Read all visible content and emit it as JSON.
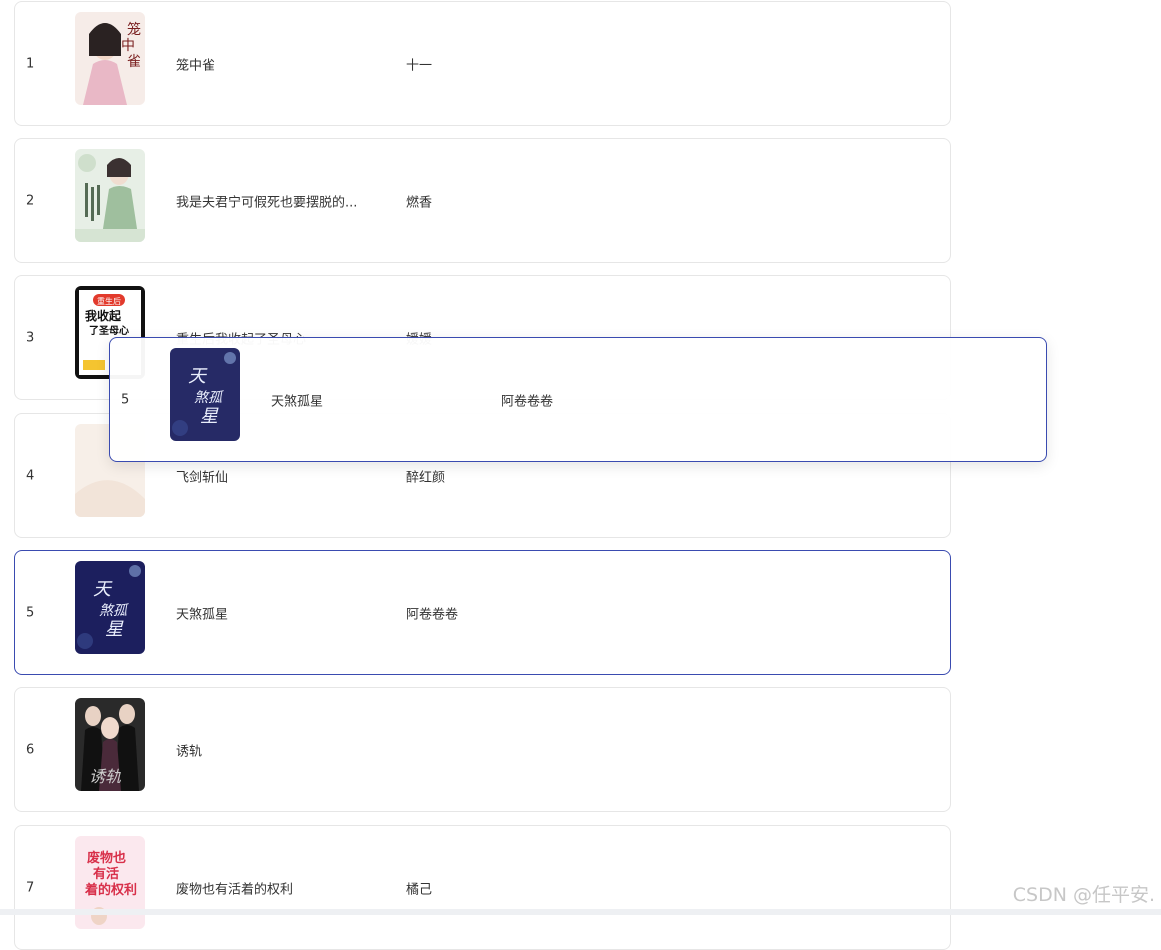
{
  "rows": [
    {
      "index": "1",
      "title": "笼中雀",
      "author": "十一",
      "cover_icon": "book-cover-cage-bird"
    },
    {
      "index": "2",
      "title": "我是夫君宁可假死也要摆脱的...",
      "author": "燃香",
      "cover_icon": "book-cover-green-lady"
    },
    {
      "index": "3",
      "title": "重生后我收起了圣母心",
      "author": "媛媛",
      "cover_icon": "book-cover-comic"
    },
    {
      "index": "4",
      "title": "飞剑斩仙",
      "author": "醉红颜",
      "cover_icon": "book-cover-pale"
    },
    {
      "index": "5",
      "title": "天煞孤星",
      "author": "阿卷卷卷",
      "cover_icon": "book-cover-night-sky"
    },
    {
      "index": "6",
      "title": "诱轨",
      "author": "",
      "cover_icon": "book-cover-couple"
    },
    {
      "index": "7",
      "title": "废物也有活着的权利",
      "author": "橘己",
      "cover_icon": "book-cover-pink"
    }
  ],
  "drag_preview": {
    "index": "5",
    "title": "天煞孤星",
    "author": "阿卷卷卷",
    "cover_icon": "book-cover-night-sky"
  },
  "watermark": "CSDN @任平安.",
  "colors": {
    "active_border": "#3a4bb0",
    "row_border": "#e6e6e6"
  }
}
